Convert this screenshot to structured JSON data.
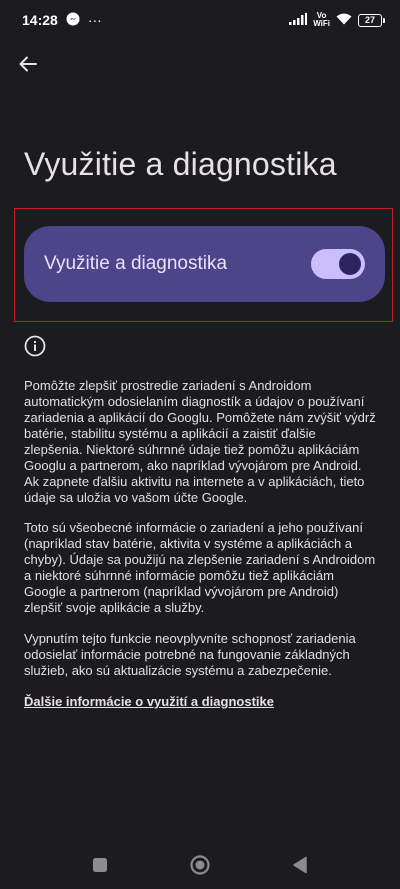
{
  "status_bar": {
    "time": "14:28",
    "more": "···",
    "network_top": "Vo",
    "network_bottom": "WiFi",
    "battery": "27"
  },
  "header": {
    "title": "Využitie a diagnostika"
  },
  "main_switch": {
    "label": "Využitie a diagnostika",
    "checked": true
  },
  "body": {
    "paragraph_1": "Pomôžte zlepšiť prostredie zariadení s Androidom automatickým odosielaním diagnostík a údajov o používaní zariadenia a aplikácií do Googlu. Pomôžete nám zvýšiť výdrž batérie, stabilitu systému a aplikácií a zaistiť ďalšie zlepšenia. Niektoré súhrnné údaje tiež pomôžu aplikáciám Googlu a partnerom, ako napríklad vývojárom pre Android. Ak zapnete ďalšiu aktivitu na internete a v aplikáciách, tieto údaje sa uložia vo vašom účte Google.",
    "paragraph_2": "Toto sú všeobecné informácie o zariadení a jeho používaní (napríklad stav batérie, aktivita v systéme a aplikáciách a chyby). Údaje sa použijú na zlepšenie zariadení s Androidom a niektoré súhrnné informácie pomôžu tiež aplikáciám Google a partnerom (napríklad vývojárom pre Android) zlepšiť svoje aplikácie a služby.",
    "paragraph_3": "Vypnutím tejto funkcie neovplyvníte schopnosť zariadenia odosielať informácie potrebné na fungovanie základných služieb, ako sú aktualizácie systému a zabezpečenie.",
    "learn_more_link": "Ďalšie informácie o využití a diagnostike"
  },
  "icons": {
    "back": "arrow-back-icon",
    "info": "info-icon",
    "messenger": "messenger-icon",
    "signal": "signal-icon",
    "wifi": "wifi-icon",
    "battery": "battery-icon",
    "nav_recents": "square-icon",
    "nav_home": "circle-icon",
    "nav_back": "triangle-icon"
  },
  "colors": {
    "background": "#1c1b20",
    "switch_container": "#4d4489",
    "toggle_track": "#cbbeff",
    "toggle_thumb": "#2e2461",
    "highlight_border": "#c4202a"
  }
}
